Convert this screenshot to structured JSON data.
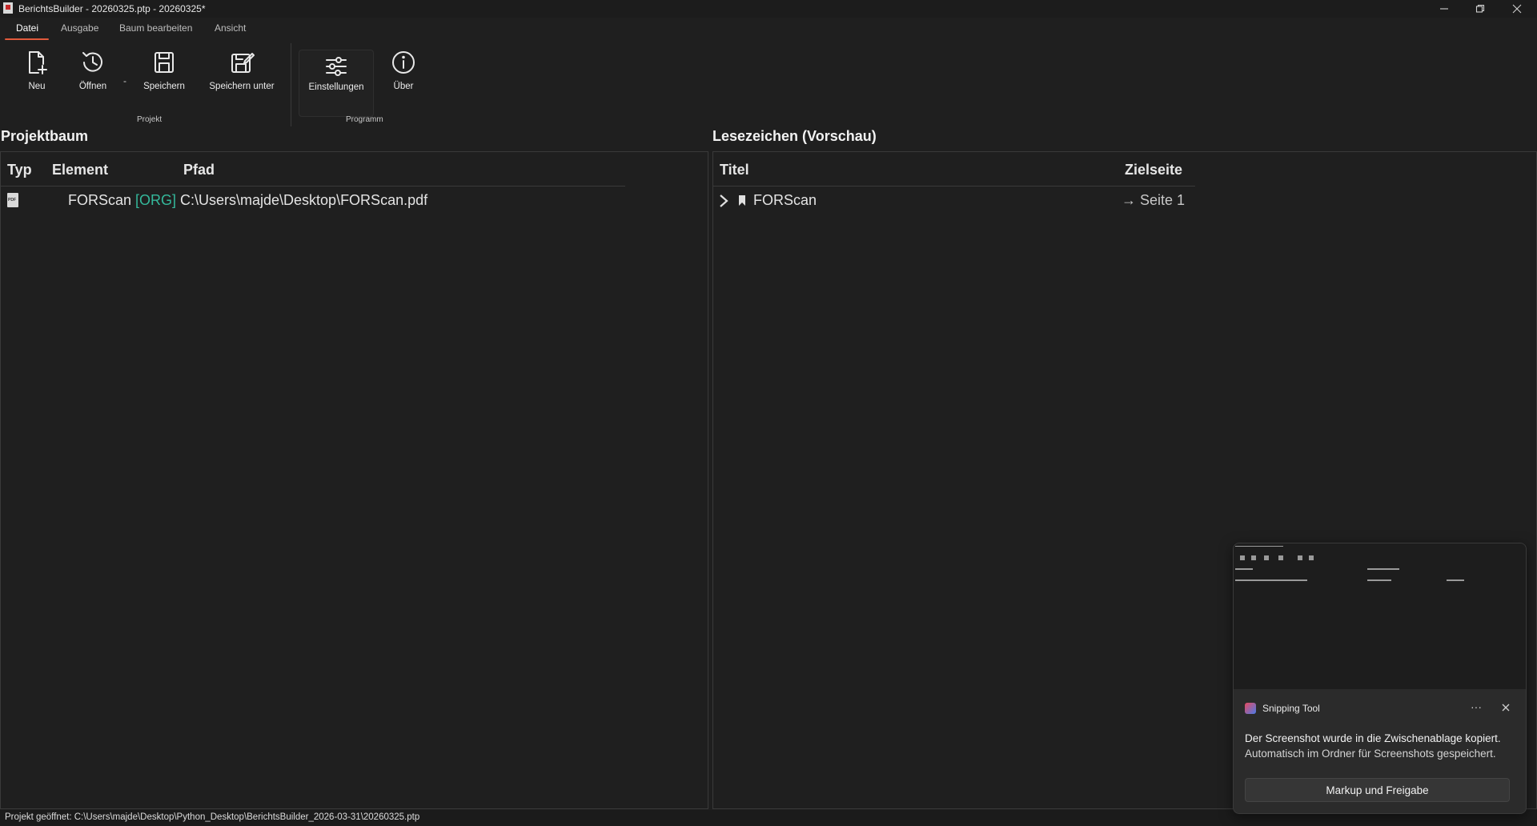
{
  "window": {
    "title": "BerichtsBuilder - 20260325.ptp - 20260325*"
  },
  "tabs": [
    {
      "label": "Datei"
    },
    {
      "label": "Ausgabe"
    },
    {
      "label": "Baum bearbeiten"
    },
    {
      "label": "Ansicht"
    }
  ],
  "ribbon": {
    "new_label": "Neu",
    "open_label": "Öffnen",
    "open_dash": "-",
    "save_label": "Speichern",
    "save_as_label": "Speichern unter",
    "settings_label": "Einstellungen",
    "about_label": "Über",
    "group_project": "Projekt",
    "group_program": "Programm"
  },
  "project_tree": {
    "title": "Projektbaum",
    "columns": {
      "type": "Typ",
      "element": "Element",
      "path": "Pfad"
    },
    "rows": [
      {
        "icon": "pdf-file-icon",
        "name": "FORScan",
        "tag": "[ORG]",
        "path": "C:\\Users\\majde\\Desktop\\FORScan.pdf"
      }
    ]
  },
  "bookmarks": {
    "title": "Lesezeichen (Vorschau)",
    "columns": {
      "title": "Titel",
      "target": "Zielseite"
    },
    "rows": [
      {
        "icon": "bookmark-icon",
        "title": "FORScan",
        "target": "→ Seite 1"
      }
    ]
  },
  "status": {
    "text": "Projekt geöffnet: C:\\Users\\majde\\Desktop\\Python_Desktop\\BerichtsBuilder_2026-03-31\\20260325.ptp"
  },
  "notification": {
    "app": "Snipping Tool",
    "more": "···",
    "line1": "Der Screenshot wurde in die Zwischenablage kopiert.",
    "line2": "Automatisch im Ordner für Screenshots gespeichert.",
    "button": "Markup und Freigabe"
  },
  "colors": {
    "background": "#1f1f1f",
    "accent_tab": "#e25a3c",
    "org_tag": "#34b89b"
  }
}
